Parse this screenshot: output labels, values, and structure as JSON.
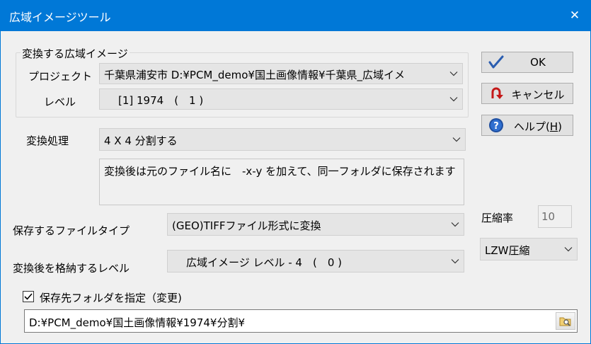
{
  "window": {
    "title": "広域イメージツール",
    "close_glyph": "✕"
  },
  "group": {
    "legend": "変換する広域イメージ",
    "project_label": "プロジェクト",
    "project_value": "千葉県浦安市 D:¥PCM_demo¥国土画像情報¥千葉県_広域イメ",
    "level_label": "レベル",
    "level_value": "[1] 1974　(　1 )"
  },
  "convert": {
    "label": "変換処理",
    "value": "4 X 4 分割する",
    "description": "変換後は元のファイル名に　-x-y を加えて、同一フォルダに保存されます"
  },
  "filetype": {
    "label": "保存するファイルタイプ",
    "value": "(GEO)TIFFファイル形式に変換"
  },
  "target_level": {
    "label": "変換後を格納するレベル",
    "value": "広域イメージ レベル - 4　(　0 )"
  },
  "compression": {
    "label": "圧縮率",
    "rate": "10",
    "method": "LZW圧縮"
  },
  "buttons": {
    "ok": "OK",
    "cancel": "キャンセル",
    "help_prefix": "ヘルプ(",
    "help_key": "H",
    "help_suffix": ")"
  },
  "folder": {
    "checkbox_label": "保存先フォルダを指定（変更)",
    "checked": true,
    "path": "D:¥PCM_demo¥国土画像情報¥1974¥分割¥"
  },
  "colors": {
    "titlebar": "#0078d7",
    "ok_check": "#2a5db0",
    "cancel_arrow": "#c41818",
    "help_icon": "#1f4fa0"
  }
}
